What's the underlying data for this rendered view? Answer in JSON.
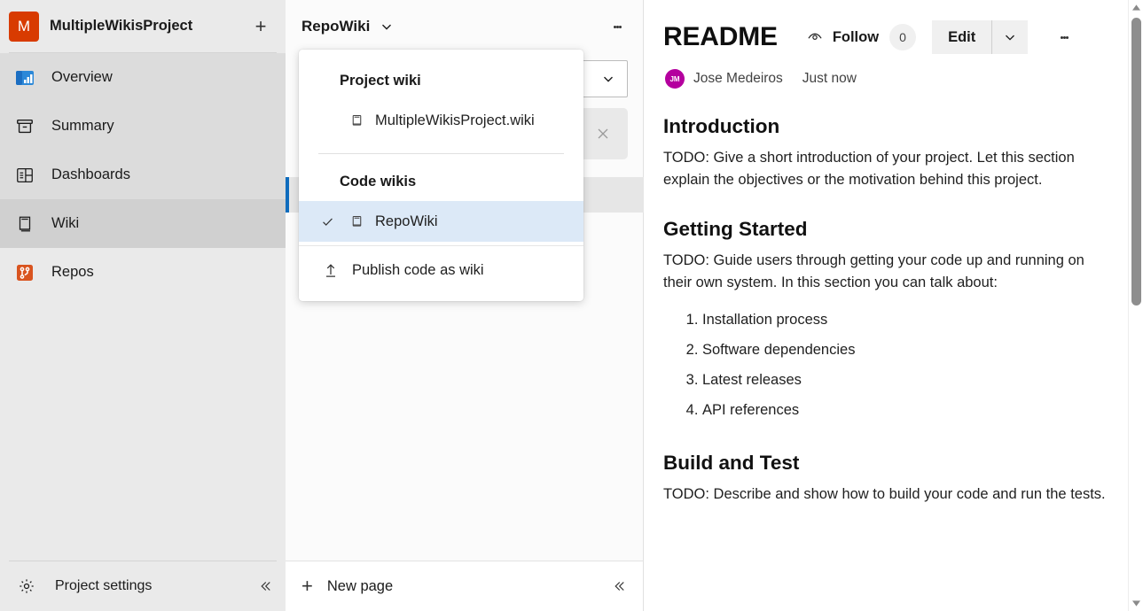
{
  "project": {
    "logo_letter": "M",
    "logo_color": "#d83b01",
    "name": "MultipleWikisProject",
    "add_icon": "plus-icon",
    "settings_label": "Project settings",
    "collapse_icon": "chevron-double-left-icon",
    "nav": [
      {
        "label": "Overview",
        "icon": "overview-icon",
        "state": "shade"
      },
      {
        "label": "Summary",
        "icon": "summary-icon",
        "state": "shade"
      },
      {
        "label": "Dashboards",
        "icon": "dashboards-icon",
        "state": "shade"
      },
      {
        "label": "Wiki",
        "icon": "wiki-book-icon",
        "state": "selected"
      },
      {
        "label": "Repos",
        "icon": "repos-icon",
        "state": "normal"
      }
    ]
  },
  "wiki_panel": {
    "current_wiki": "RepoWiki",
    "chevron_icon": "chevron-down-icon",
    "more_icon": "more-vertical-icon",
    "filter_chevron_icon": "chevron-down-icon",
    "clear_icon": "close-icon",
    "new_page_label": "New page",
    "new_page_icon": "plus-icon",
    "collapse_icon": "chevron-double-left-icon"
  },
  "flyout": {
    "project_wiki_header": "Project wiki",
    "project_wiki_item": {
      "label": "MultipleWikisProject.wiki",
      "icon": "book-icon"
    },
    "code_wikis_header": "Code wikis",
    "code_wikis_items": [
      {
        "label": "RepoWiki",
        "icon": "book-icon",
        "selected": true,
        "check_icon": "check-icon"
      }
    ],
    "publish": {
      "label": "Publish code as wiki",
      "icon": "publish-upload-icon"
    }
  },
  "readme": {
    "title": "README",
    "follow_label": "Follow",
    "follow_icon": "eye-icon",
    "follow_count": "0",
    "edit_label": "Edit",
    "edit_chevron_icon": "chevron-down-icon",
    "more_icon": "more-vertical-icon",
    "author_initials": "JM",
    "author_name": "Jose Medeiros",
    "timestamp": "Just now",
    "avatar_color": "#b4009e",
    "sections": [
      {
        "heading": "Introduction",
        "paragraph": "TODO: Give a short introduction of your project. Let this section explain the objectives or the motivation behind this project."
      },
      {
        "heading": "Getting Started",
        "paragraph": "TODO: Guide users through getting your code up and running on their own system. In this section you can talk about:",
        "list": [
          "Installation process",
          "Software dependencies",
          "Latest releases",
          "API references"
        ]
      },
      {
        "heading": "Build and Test",
        "paragraph": "TODO: Describe and show how to build your code and run the tests."
      }
    ]
  },
  "scrollbar": {
    "up_icon": "triangle-up-icon",
    "down_icon": "triangle-down-icon"
  },
  "colors": {
    "accent": "#0f6cbd",
    "brand_orange": "#d83b01",
    "menu_highlight": "#dce9f7"
  }
}
